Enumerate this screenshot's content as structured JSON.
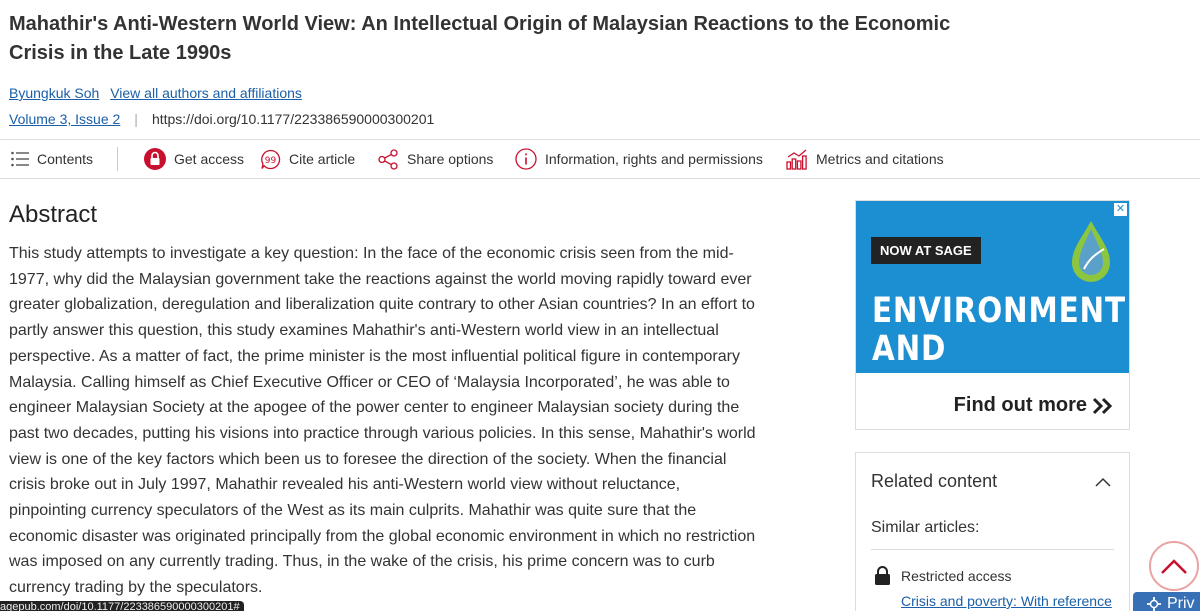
{
  "article": {
    "title": "Mahathir's Anti-Western World View: An Intellectual Origin of Malaysian Reactions to the Economic Crisis in the Late 1990s",
    "author": "Byungkuk Soh",
    "view_authors": "View all authors and affiliations",
    "volume_issue": "Volume 3, Issue 2",
    "doi": "https://doi.org/10.1177/223386590000300201"
  },
  "toolbar": {
    "contents": "Contents",
    "get_access": "Get access",
    "cite": "Cite article",
    "share": "Share options",
    "info": "Information, rights and permissions",
    "metrics": "Metrics and citations"
  },
  "abstract": {
    "heading": "Abstract",
    "text": "This study attempts to investigate a key question: In the face of the economic crisis seen from the mid-1977, why did the Malaysian government take the reactions against the world moving rapidly toward ever greater globalization, deregulation and liberalization quite contrary to other Asian countries? In an effort to partly answer this question, this study examines Mahathir's anti-Western world view in an intellectual perspective. As a matter of fact, the prime minister is the most influential political figure in contemporary Malaysia. Calling himself as Chief Executive Officer or CEO of ‘Malaysia Incorporated’, he was able to engineer Malaysian Society at the apogee of the power center to engineer Malaysian society during the past two decades, putting his visions into practice through various policies. In this sense, Mahathir's world view is one of the key factors which been us to foresee the direction of the society. When the financial crisis broke out in July 1997, Mahathir revealed his anti-Western world view without reluctance, pinpointing currency speculators of the West as its main culprits. Mahathir was quite sure that the economic disaster was originated principally from the global economic environment in which no restriction was imposed on any currently trading. Thus, in the wake of the crisis, his prime concern was to curb currency trading by the speculators."
  },
  "ad": {
    "badge": "NOW AT SAGE",
    "line1": "ENVIRONMENT",
    "line2": "AND SECURITY",
    "cta": "Find out more",
    "close": "✕"
  },
  "related": {
    "heading": "Related content",
    "similar": "Similar articles:",
    "restricted": "Restricted access",
    "link": "Crisis and poverty: With reference"
  },
  "status_url": "agepub.com/doi/10.1177/223386590000300201#",
  "privacy_label": "Priv",
  "colors": {
    "link": "#1a5fa8",
    "ad_bg": "#1c8fd3",
    "access_red": "#c8102e",
    "privacy_bg": "#3870b6"
  }
}
